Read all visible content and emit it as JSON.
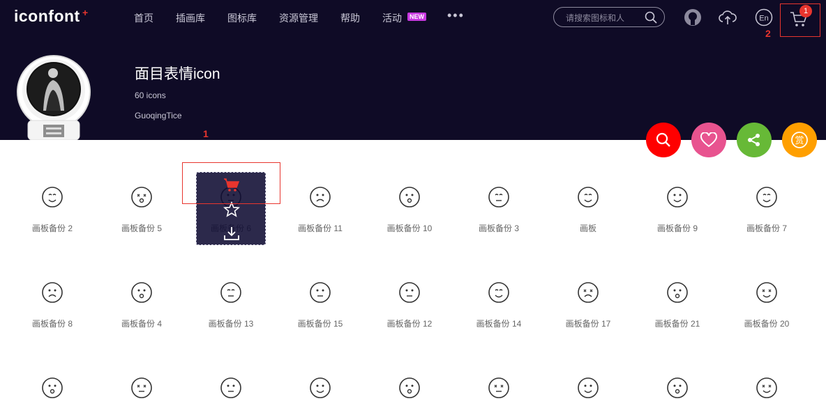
{
  "brand": {
    "logo_text": "iconfont",
    "logo_plus": "+"
  },
  "nav": [
    "首页",
    "插画库",
    "图标库",
    "资源管理",
    "帮助",
    "活动"
  ],
  "nav_badge": "NEW",
  "nav_more": "•••",
  "search": {
    "placeholder": "请搜索图标和人"
  },
  "header_icons": [
    "github-icon",
    "upload-icon",
    "language-en-icon",
    "cart-icon"
  ],
  "language_label": "En",
  "cart": {
    "count": "1"
  },
  "annotations": {
    "cart_marker": "2",
    "hover_marker": "1"
  },
  "icon_set": {
    "title": "面目表情icon",
    "count_text": "60 icons",
    "author": "GuoqingTice"
  },
  "fabs": [
    {
      "name": "search-icon",
      "color": "#ff0000"
    },
    {
      "name": "heart-icon",
      "color": "#e8538f"
    },
    {
      "name": "share-icon",
      "color": "#67b937"
    },
    {
      "name": "reward-icon",
      "color": "#ff9f00",
      "label": "赏"
    }
  ],
  "icons_row1": [
    "画板备份 2",
    "画板备份 5",
    "画板备份 6",
    "画板备份 11",
    "画板备份 10",
    "画板备份 3",
    "画板",
    "画板备份 9",
    "画板备份 7"
  ],
  "icons_row2": [
    "画板备份 8",
    "画板备份 4",
    "画板备份 13",
    "画板备份 15",
    "画板备份 12",
    "画板备份 14",
    "画板备份 17",
    "画板备份 21",
    "画板备份 20"
  ],
  "hover_actions": [
    "add-to-cart-icon",
    "collect-star-icon",
    "download-icon"
  ],
  "colors": {
    "header_bg": "#0f0b26",
    "accent_red": "#e8352e",
    "new_badge": "#c737e0"
  }
}
